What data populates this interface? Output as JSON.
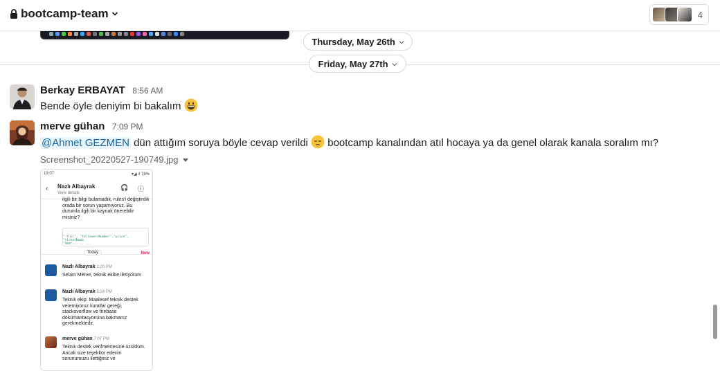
{
  "header": {
    "channel_name": "bootcamp-team",
    "member_count": "4"
  },
  "dates": {
    "thursday": "Thursday, May 26th",
    "friday": "Friday, May 27th"
  },
  "messages": [
    {
      "author": "Berkay ERBAYAT",
      "time": "8:56 AM",
      "text": "Bende öyle deniyim bi bakalım"
    },
    {
      "author": "merve gühan",
      "time": "7:09 PM",
      "mention": "@Ahmet GEZMEN",
      "text_before_emoji": " dün attığım soruya böyle cevap verildi ",
      "text_after_emoji": " bootcamp kanalından atıl hocaya ya da genel olarak kanala soralım mı?",
      "attachment": {
        "filename": "Screenshot_20220527-190749.jpg",
        "preview": {
          "status_time": "19:07",
          "status_right": "▾◢ ıl 78%",
          "title": "Nazlı Albayrak",
          "subtitle": "View details",
          "top_text": "ilgili bir bilgi bulamadık, rules'i değiştirdik orada bir sorun yaşamıyoruz.  Bu durumla ilgili bir kaynak önerebilir misiniz?",
          "code_line1": "\":full\", \"followersNumber\",\"price\", \"ticketNumb",
          "code_line2": "\"Gmm\"... .. ...",
          "today": "Today",
          "new": "New",
          "m1_name": "Nazlı Albayrak",
          "m1_time": "1:20 PM",
          "m1_text": "Selam Merve, teknik ekibe iletiyorum",
          "m2_name": "Nazlı Albayrak",
          "m2_time": "5:24 PM",
          "m2_text": "Teknik ekip: Maalesef teknik destek veremiyoruz kurallar gereği, stackoverflow ve firebase dökümantasyonuna bakmanız gerekmektedir.",
          "m3_name": "merve gühan",
          "m3_time": "7:07 PM",
          "m3_text": "Teknik destek verilmemesine üzüldüm. Ancak size teşekkür ederim sorunumuzu ilettiğiniz ve"
        }
      }
    }
  ],
  "icons": [
    "lock-icon",
    "chevron-down-icon",
    "grinning-face-emoji",
    "pensive-face-emoji",
    "back-arrow-icon",
    "headphones-icon",
    "info-icon"
  ]
}
